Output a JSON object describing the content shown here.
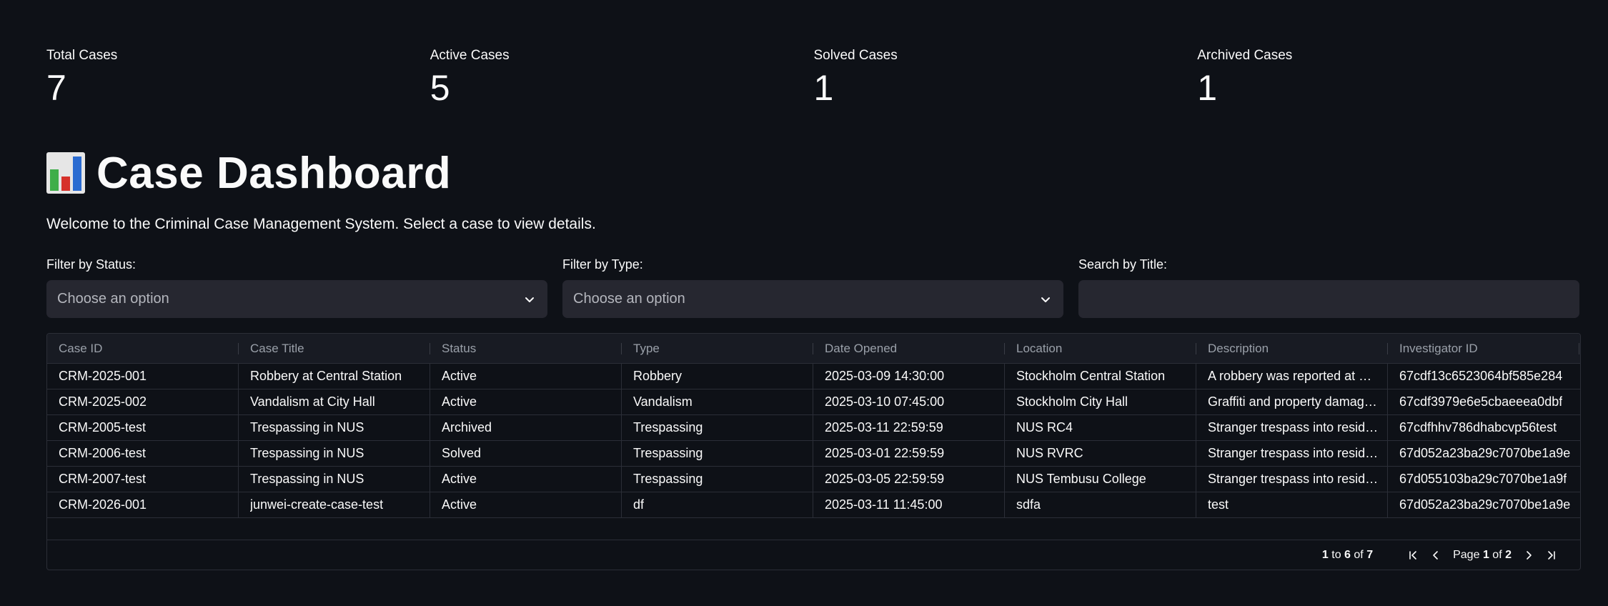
{
  "metrics": [
    {
      "label": "Total Cases",
      "value": "7"
    },
    {
      "label": "Active Cases",
      "value": "5"
    },
    {
      "label": "Solved Cases",
      "value": "1"
    },
    {
      "label": "Archived Cases",
      "value": "1"
    }
  ],
  "header": {
    "icon": "bar-chart-icon",
    "title": "Case Dashboard",
    "welcome": "Welcome to the Criminal Case Management System. Select a case to view details."
  },
  "filters": {
    "status": {
      "label": "Filter by Status:",
      "placeholder": "Choose an option"
    },
    "type": {
      "label": "Filter by Type:",
      "placeholder": "Choose an option"
    },
    "search": {
      "label": "Search by Title:",
      "value": ""
    }
  },
  "table": {
    "columns": [
      "Case ID",
      "Case Title",
      "Status",
      "Type",
      "Date Opened",
      "Location",
      "Description",
      "Investigator ID"
    ],
    "rows": [
      [
        "CRM-2025-001",
        "Robbery at Central Station",
        "Active",
        "Robbery",
        "2025-03-09 14:30:00",
        "Stockholm Central Station",
        "A robbery was reported at St…",
        "67cdf13c6523064bf585e284"
      ],
      [
        "CRM-2025-002",
        "Vandalism at City Hall",
        "Active",
        "Vandalism",
        "2025-03-10 07:45:00",
        "Stockholm City Hall",
        "Graffiti and property damag…",
        "67cdf3979e6e5cbaeeea0dbf"
      ],
      [
        "CRM-2005-test",
        "Trespassing in NUS",
        "Archived",
        "Trespassing",
        "2025-03-11 22:59:59",
        "NUS RC4",
        "Stranger trespass into reside…",
        "67cdfhhv786dhabcvp56test"
      ],
      [
        "CRM-2006-test",
        "Trespassing in NUS",
        "Solved",
        "Trespassing",
        "2025-03-01 22:59:59",
        "NUS RVRC",
        "Stranger trespass into reside…",
        "67d052a23ba29c7070be1a9e"
      ],
      [
        "CRM-2007-test",
        "Trespassing in NUS",
        "Active",
        "Trespassing",
        "2025-03-05 22:59:59",
        "NUS Tembusu College",
        "Stranger trespass into reside…",
        "67d055103ba29c7070be1a9f"
      ],
      [
        "CRM-2026-001",
        "junwei-create-case-test",
        "Active",
        "df",
        "2025-03-11 11:45:00",
        "sdfa",
        "test",
        "67d052a23ba29c7070be1a9e"
      ]
    ]
  },
  "pagination": {
    "range_start": "1",
    "range_to": "to",
    "range_end": "6",
    "range_of": "of",
    "total": "7",
    "page_label": "Page",
    "page_current": "1",
    "page_of": "of",
    "page_total": "2"
  },
  "colors": {
    "background": "#0e1117",
    "input_bg": "#262730",
    "header_bg": "#181b23",
    "border": "#2b2e37"
  }
}
